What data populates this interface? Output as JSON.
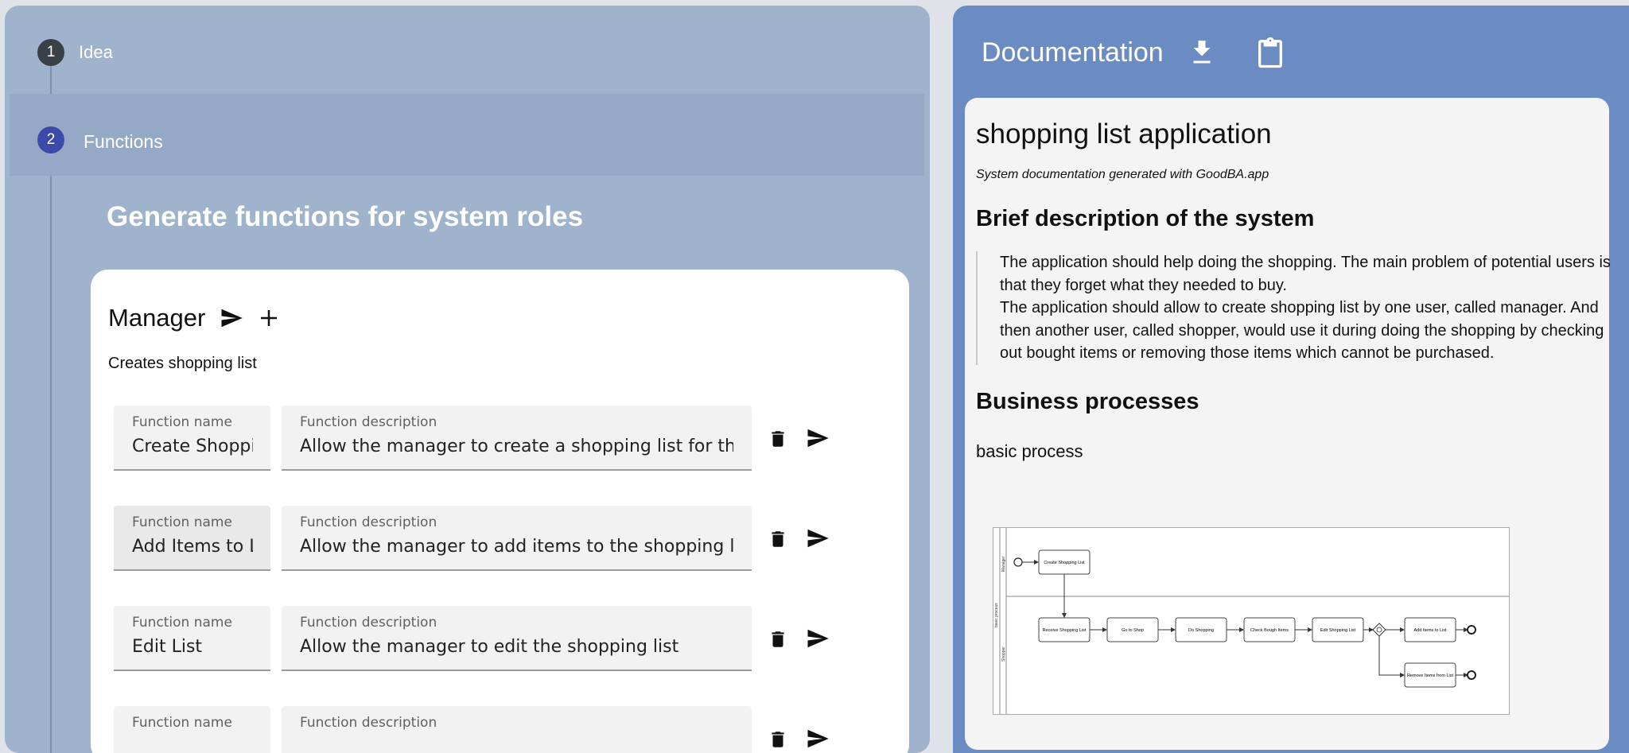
{
  "stepper": {
    "steps": [
      {
        "number": "1",
        "label": "Idea"
      },
      {
        "number": "2",
        "label": "Functions"
      }
    ]
  },
  "section": {
    "title": "Generate functions for system roles"
  },
  "role": {
    "name": "Manager",
    "description": "Creates shopping list",
    "functions": [
      {
        "name_label": "Function name",
        "name_value": "Create Shopping List",
        "desc_label": "Function description",
        "desc_value": "Allow the manager to create a shopping list for the shopper"
      },
      {
        "name_label": "Function name",
        "name_value": "Add Items to List",
        "desc_label": "Function description",
        "desc_value": "Allow the manager to add items to the shopping list"
      },
      {
        "name_label": "Function name",
        "name_value": "Edit List",
        "desc_label": "Function description",
        "desc_value": "Allow the manager to edit the shopping list"
      },
      {
        "name_label": "Function name",
        "name_value": "",
        "desc_label": "Function description",
        "desc_value": ""
      }
    ]
  },
  "documentation": {
    "header_title": "Documentation",
    "icons": {
      "download": "download-icon",
      "clipboard": "clipboard-icon"
    },
    "title": "shopping list application",
    "meta": "System documentation generated with GoodBA.app",
    "brief_heading": "Brief description of the system",
    "brief_paragraphs": [
      "The application should help doing the shopping. The main problem of potential users is that they forget what they needed to buy.",
      "The application should allow to create shopping list by one user, called manager. And then another user, called shopper, would use it during doing the shopping by checking out bought items or removing those items which cannot be purchased."
    ],
    "processes_heading": "Business processes",
    "process_name": "basic process",
    "diagram": {
      "pool": "basic process",
      "lanes": [
        "Manager",
        "Shopper"
      ],
      "tasks": [
        "Create Shopping List",
        "Receive Shopping List",
        "Go to Shop",
        "Do Shopping",
        "Check Bough Items",
        "Edit Shopping List",
        "Add Items to List",
        "Remove Items from List"
      ]
    }
  },
  "colors": {
    "left_panel": "#9fb3cd",
    "right_panel": "#6b8bc3",
    "active_step": "#3b4aa8"
  }
}
